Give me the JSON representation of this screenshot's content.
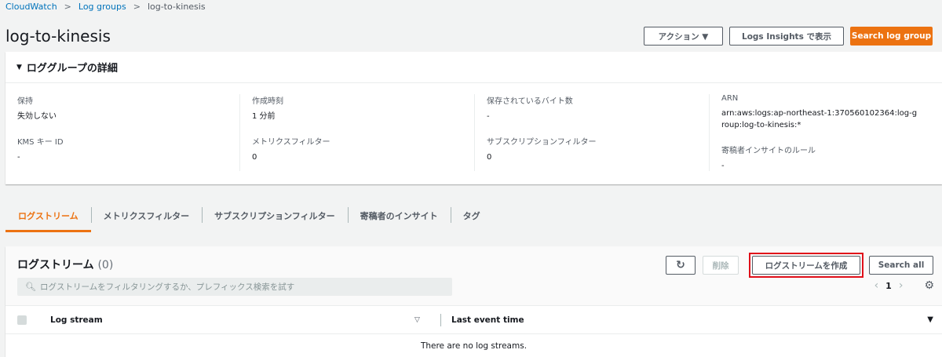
{
  "breadcrumb": {
    "items": [
      "CloudWatch",
      "Log groups"
    ],
    "current": "log-to-kinesis"
  },
  "page": {
    "title": "log-to-kinesis",
    "actions_label": "アクション ▼",
    "insights_label": "Logs Insights で表示",
    "search_group_label": "Search log group"
  },
  "details": {
    "title": "ロググループの詳細",
    "retention_label": "保持",
    "retention_value": "失効しない",
    "kms_label": "KMS キー ID",
    "kms_value": "-",
    "created_label": "作成時刻",
    "created_value": "1 分前",
    "metric_filter_label": "メトリクスフィルター",
    "metric_filter_value": "0",
    "stored_bytes_label": "保存されているバイト数",
    "stored_bytes_value": "-",
    "subscription_label": "サブスクリプションフィルター",
    "subscription_value": "0",
    "arn_label": "ARN",
    "arn_value": "arn:aws:logs:ap-northeast-1:370560102364:log-group:log-to-kinesis:*",
    "contributor_label": "寄稿者インサイトのルール",
    "contributor_value": "-"
  },
  "tabs": [
    {
      "label": "ログストリーム",
      "active": true
    },
    {
      "label": "メトリクスフィルター",
      "active": false
    },
    {
      "label": "サブスクリプションフィルター",
      "active": false
    },
    {
      "label": "寄稿者のインサイト",
      "active": false
    },
    {
      "label": "タグ",
      "active": false
    }
  ],
  "streams": {
    "title": "ログストリーム",
    "count": "(0)",
    "refresh_icon": "↻",
    "delete_label": "削除",
    "create_label": "ログストリームを作成",
    "search_all_label": "Search all",
    "filter_placeholder": "ログストリームをフィルタリングするか、プレフィックス検索を試す",
    "page_number": "1",
    "col_stream": "Log stream",
    "col_last_event": "Last event time",
    "empty_message": "There are no log streams."
  },
  "colors": {
    "accent": "#ec7211",
    "link": "#0073bb",
    "highlight_box": "#e0101a"
  }
}
